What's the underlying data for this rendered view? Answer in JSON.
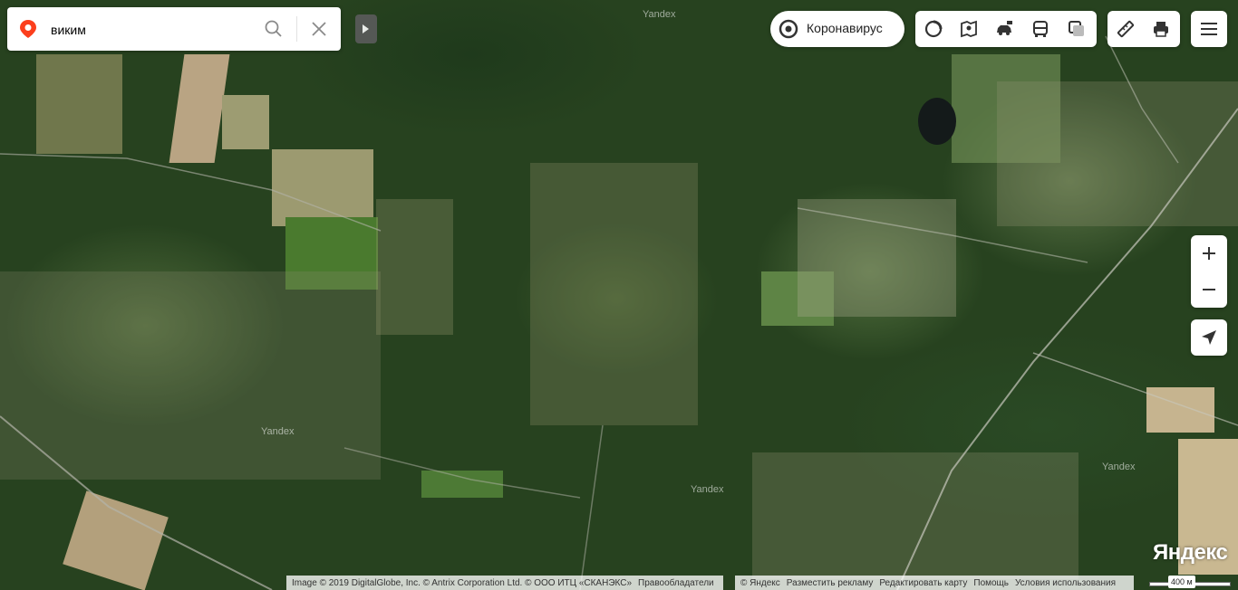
{
  "search": {
    "query": "виким"
  },
  "covid_button": {
    "label": "Коронавирус"
  },
  "toolbar_layers": [
    "traffic-icon",
    "panorama-icon",
    "car-icon",
    "transit-bus-icon",
    "layers-icon"
  ],
  "toolbar_tools": [
    "ruler-icon",
    "print-icon"
  ],
  "map": {
    "watermarks": [
      "Yandex",
      "Yandex",
      "Yandex",
      "Yandex"
    ],
    "logo": "Яндекс",
    "scale_label": "400 м"
  },
  "footer": {
    "imagery": "Image © 2019 DigitalGlobe, Inc. © Antrix Corporation Ltd. © ООО ИТЦ «СКАНЭКС»",
    "rights": "Правообладатели",
    "yandex": "© Яндекс",
    "ads": "Разместить рекламу",
    "edit": "Редактировать карту",
    "help": "Помощь",
    "terms": "Условия использования"
  },
  "colors": {
    "accent": "#fc3f1d",
    "forest": "#27421f",
    "panel": "#ffffff"
  }
}
